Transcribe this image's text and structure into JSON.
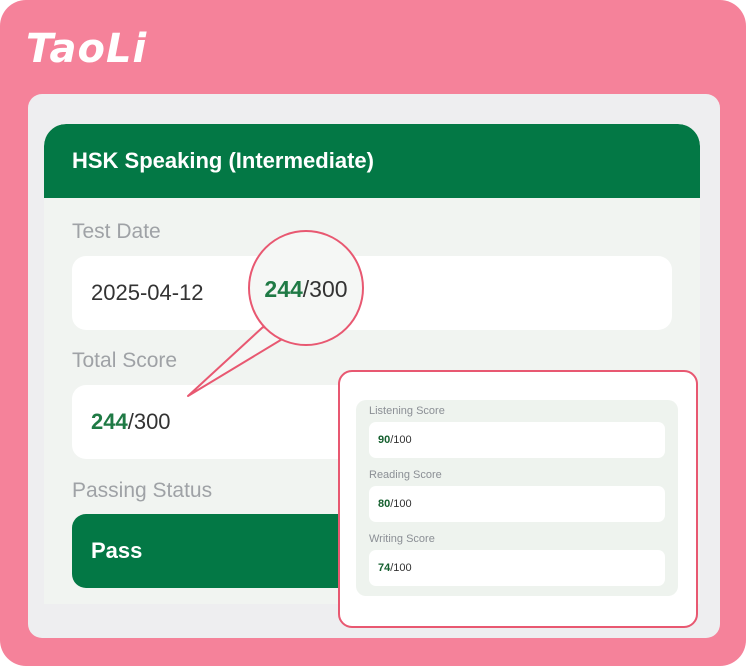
{
  "brand": {
    "logo": "TaoLi"
  },
  "card": {
    "title": "HSK Speaking (Intermediate)",
    "test_date": {
      "label": "Test Date",
      "value": "2025-04-12"
    },
    "total_score": {
      "label": "Total Score",
      "score": "244",
      "max": "/300"
    },
    "passing_status": {
      "label": "Passing Status",
      "value": "Pass"
    }
  },
  "callout": {
    "score": "244",
    "max": "/300"
  },
  "subscores": [
    {
      "label": "Listening Score",
      "score": "90",
      "max": "/100"
    },
    {
      "label": "Reading Score",
      "score": "80",
      "max": "/100"
    },
    {
      "label": "Writing Score",
      "score": "74",
      "max": "/100"
    }
  ],
  "colors": {
    "accent_green": "#037845",
    "frame_pink": "#f5829a",
    "highlight_red": "#e85871"
  }
}
